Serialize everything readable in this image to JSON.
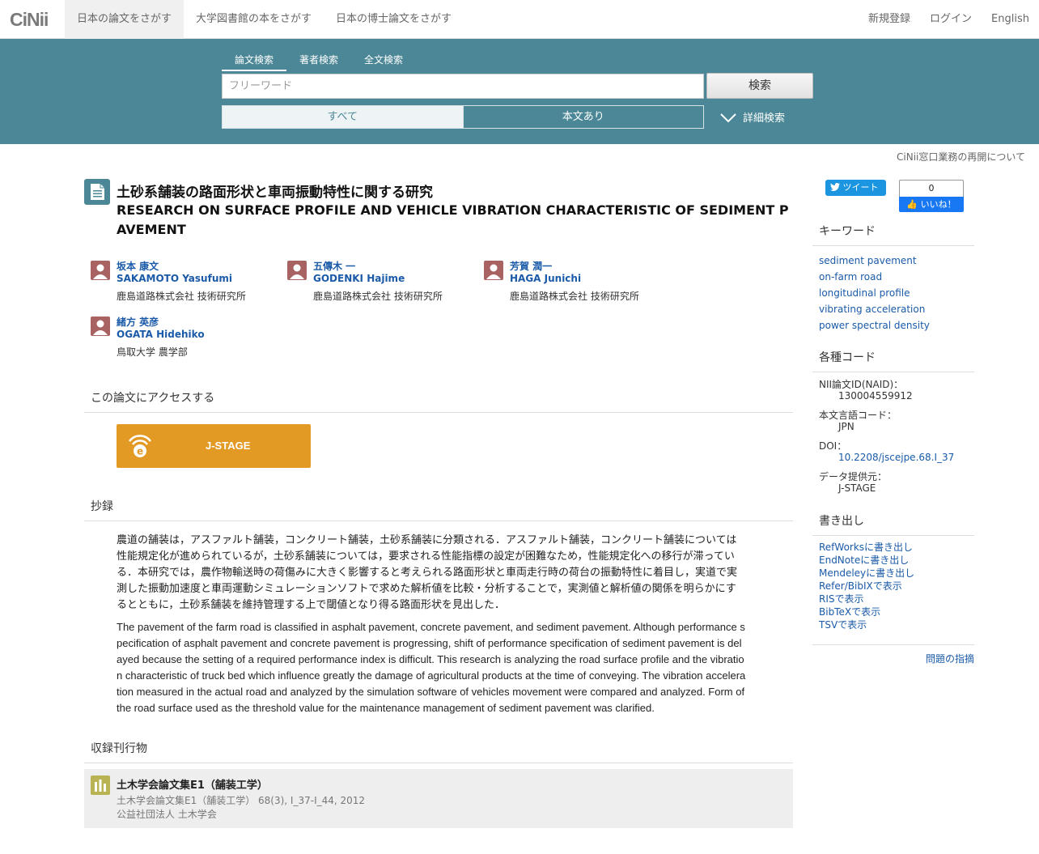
{
  "header": {
    "logo": "CiNii",
    "nav": [
      "日本の論文をさがす",
      "大学図書館の本をさがす",
      "日本の博士論文をさがす"
    ],
    "right": [
      "新規登録",
      "ログイン",
      "English"
    ]
  },
  "search": {
    "tabs": [
      "論文検索",
      "著者検索",
      "全文検索"
    ],
    "placeholder": "フリーワード",
    "button": "検索",
    "filters": [
      "すべて",
      "本文あり"
    ],
    "advanced": "詳細検索"
  },
  "notice": "CiNii窓口業務の再開について",
  "article": {
    "title_ja": "土砂系舗装の路面形状と車両振動特性に関する研究",
    "title_en": "RESEARCH ON SURFACE PROFILE AND VEHICLE VIBRATION CHARACTERISTIC OF SEDIMENT PAVEMENT",
    "authors": [
      {
        "name_ja": "坂本 康文",
        "name_en": "SAKAMOTO Yasufumi",
        "affiliation": "鹿島道路株式会社 技術研究所"
      },
      {
        "name_ja": "五傳木 一",
        "name_en": "GODENKI Hajime",
        "affiliation": "鹿島道路株式会社 技術研究所"
      },
      {
        "name_ja": "芳賀 潤一",
        "name_en": "HAGA Junichi",
        "affiliation": "鹿島道路株式会社 技術研究所"
      },
      {
        "name_ja": "緒方 英彦",
        "name_en": "OGATA Hidehiko",
        "affiliation": "鳥取大学 農学部"
      }
    ],
    "access_heading": "この論文にアクセスする",
    "jstage_label": "J-STAGE",
    "abstract_heading": "抄録",
    "abstract_ja": "農道の舗装は，アスファルト舗装，コンクリート舗装，土砂系舗装に分類される．アスファルト舗装，コンクリート舗装については性能規定化が進められているが，土砂系舗装については，要求される性能指標の設定が困難なため，性能規定化への移行が滞っている．本研究では，農作物輸送時の荷傷みに大きく影響すると考えられる路面形状と車両走行時の荷台の振動特性に着目し，実道で実測した振動加速度と車両運動シミュレーションソフトで求めた解析値を比較・分析することで，実測値と解析値の関係を明らかにするとともに，土砂系舗装を維持管理する上で閾値となり得る路面形状を見出した．",
    "abstract_en": "The pavement of the farm road is classified in asphalt pavement, concrete pavement, and sediment pavement. Although performance specification of asphalt pavement and concrete pavement is progressing, shift of performance specification of sediment pavement is delayed because the setting of a required performance index is difficult. This research is analyzing the road surface profile and the vibration characteristic of truck bed which influence greatly the damage of agricultural products at the time of conveying. The vibration acceleration measured in the actual road and analyzed by the simulation software of vehicles movement were compared and analyzed. Form of the road surface used as the threshold value for the maintenance management of sediment pavement was clarified.",
    "journal_heading": "収録刊行物",
    "journal": {
      "title": "土木学会論文集E1（舗装工学）",
      "detail": "土木学会論文集E1（舗装工学） 68(3), I_37-I_44, 2012",
      "publisher": "公益社団法人 土木学会"
    }
  },
  "sidebar": {
    "tweet": "ツイート",
    "like_count": "0",
    "like_label": "いいね！",
    "keywords_heading": "キーワード",
    "keywords": [
      "sediment pavement",
      "on-farm road",
      "longitudinal profile",
      "vibrating acceleration",
      "power spectral density"
    ],
    "codes_heading": "各種コード",
    "codes": [
      {
        "label": "NII論文ID(NAID)：",
        "value": "130004559912"
      },
      {
        "label": "本文言語コード：",
        "value": "JPN"
      },
      {
        "label": "DOI：",
        "value": "10.2208/jscejpe.68.I_37"
      },
      {
        "label": "データ提供元：",
        "value": "J-STAGE"
      }
    ],
    "export_heading": "書き出し",
    "export": [
      "RefWorksに書き出し",
      "EndNoteに書き出し",
      "Mendeleyに書き出し",
      "Refer/BibIXで表示",
      "RISで表示",
      "BibTeXで表示",
      "TSVで表示"
    ],
    "report": "問題の指摘"
  }
}
